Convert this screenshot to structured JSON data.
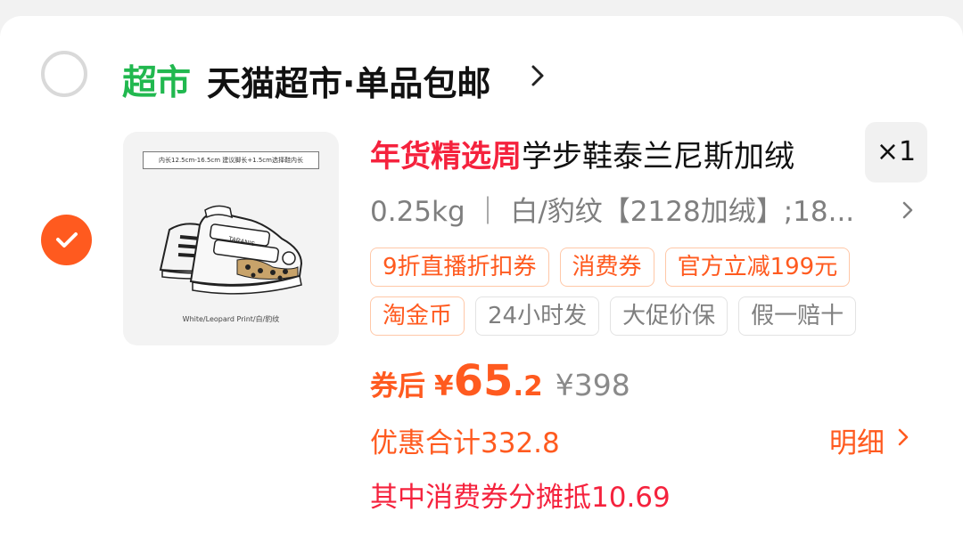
{
  "store": {
    "badge": "超市",
    "name": "天猫超市·单品包邮",
    "checked": false
  },
  "item": {
    "checked": true,
    "image": {
      "banner_text": "内长12.5cm-16.5cm   建议脚长+1.5cm选择鞋内长",
      "caption": "White/Leopard Print/白/豹纹",
      "brand_text": "TARANIS"
    },
    "title_tag": "年货精选周",
    "title": "学步鞋泰兰尼斯加绒",
    "quantity": "×1",
    "spec": "0.25kg ｜ 白/豹纹【2128加绒】;18...",
    "tags_row1": [
      "9折直播折扣券",
      "消费券",
      "官方立减199元"
    ],
    "tags_row2": [
      {
        "label": "淘金币",
        "style": "orange"
      },
      {
        "label": "24小时发",
        "style": "gray"
      },
      {
        "label": "大促价保",
        "style": "gray"
      },
      {
        "label": "假一赔十",
        "style": "gray"
      }
    ],
    "price": {
      "label": "券后",
      "currency": "¥",
      "integer": "65",
      "decimal": ".2",
      "original": "¥398"
    },
    "savings_text": "优惠合计332.8",
    "detail_label": "明细",
    "coupon_offset_text": "其中消费券分摊抵10.69"
  },
  "colors": {
    "accent_orange": "#ff5a1f",
    "promo_red": "#f5223d",
    "store_green": "#21b84f"
  }
}
